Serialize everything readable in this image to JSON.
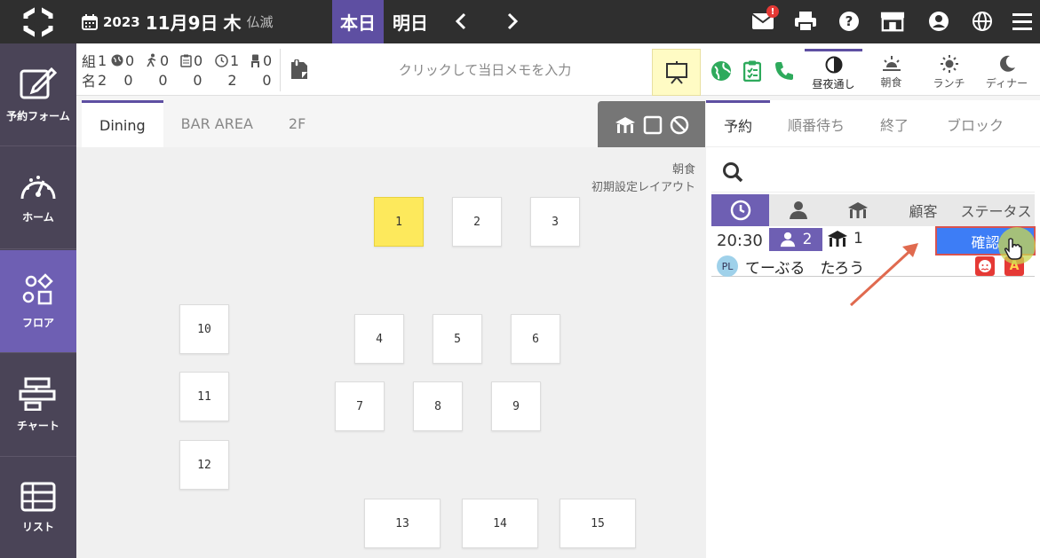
{
  "header": {
    "year": "2023",
    "month_day": "11月9日",
    "weekday": "木",
    "rokuyo": "仏滅",
    "today_label": "本日",
    "tomorrow_label": "明日",
    "mail_badge": "!"
  },
  "sidebar": {
    "items": [
      {
        "label": "予約フォーム",
        "icon": "edit-icon"
      },
      {
        "label": "ホーム",
        "icon": "gauge-icon"
      },
      {
        "label": "フロア",
        "icon": "shapes-icon"
      },
      {
        "label": "チャート",
        "icon": "chart-icon"
      },
      {
        "label": "リスト",
        "icon": "table-icon"
      }
    ]
  },
  "stats": {
    "row1_label": "組",
    "row2_label": "名",
    "row1": [
      "1",
      "0",
      "0",
      "0",
      "1",
      "0"
    ],
    "row2": [
      "2",
      "0",
      "0",
      "0",
      "2",
      "0"
    ]
  },
  "memo": {
    "placeholder": "クリックして当日メモを入力"
  },
  "meal_tabs": [
    {
      "label": "昼夜通し",
      "icon": "half-circle-icon"
    },
    {
      "label": "朝食",
      "icon": "sunrise-icon"
    },
    {
      "label": "ランチ",
      "icon": "sun-icon"
    },
    {
      "label": "ディナー",
      "icon": "moon-icon"
    }
  ],
  "floor_tabs": [
    "Dining",
    "BAR AREA",
    "2F"
  ],
  "floor": {
    "meal_note": "朝食",
    "layout_note": "初期設定レイアウト",
    "tables": [
      "1",
      "2",
      "3",
      "4",
      "5",
      "6",
      "7",
      "8",
      "9",
      "10",
      "11",
      "12",
      "13",
      "14",
      "15"
    ]
  },
  "panel": {
    "tabs": [
      "予約",
      "順番待ち",
      "終了",
      "ブロック"
    ],
    "search_placeholder": "",
    "list_headers": {
      "customer": "顧客",
      "status": "ステータス"
    },
    "reservation": {
      "time": "20:30",
      "party": "2",
      "table": "1",
      "status": "確認",
      "avatar": "PL",
      "name": "てーぶる　たろう",
      "flag2": "A"
    }
  },
  "colors": {
    "accent": "#5e4fa2",
    "topbar": "#2f2f2f",
    "sidebar": "#4a4457",
    "highlight_table": "#fde95c",
    "status_button": "#3d7df6",
    "green": "#2eaa5c"
  }
}
